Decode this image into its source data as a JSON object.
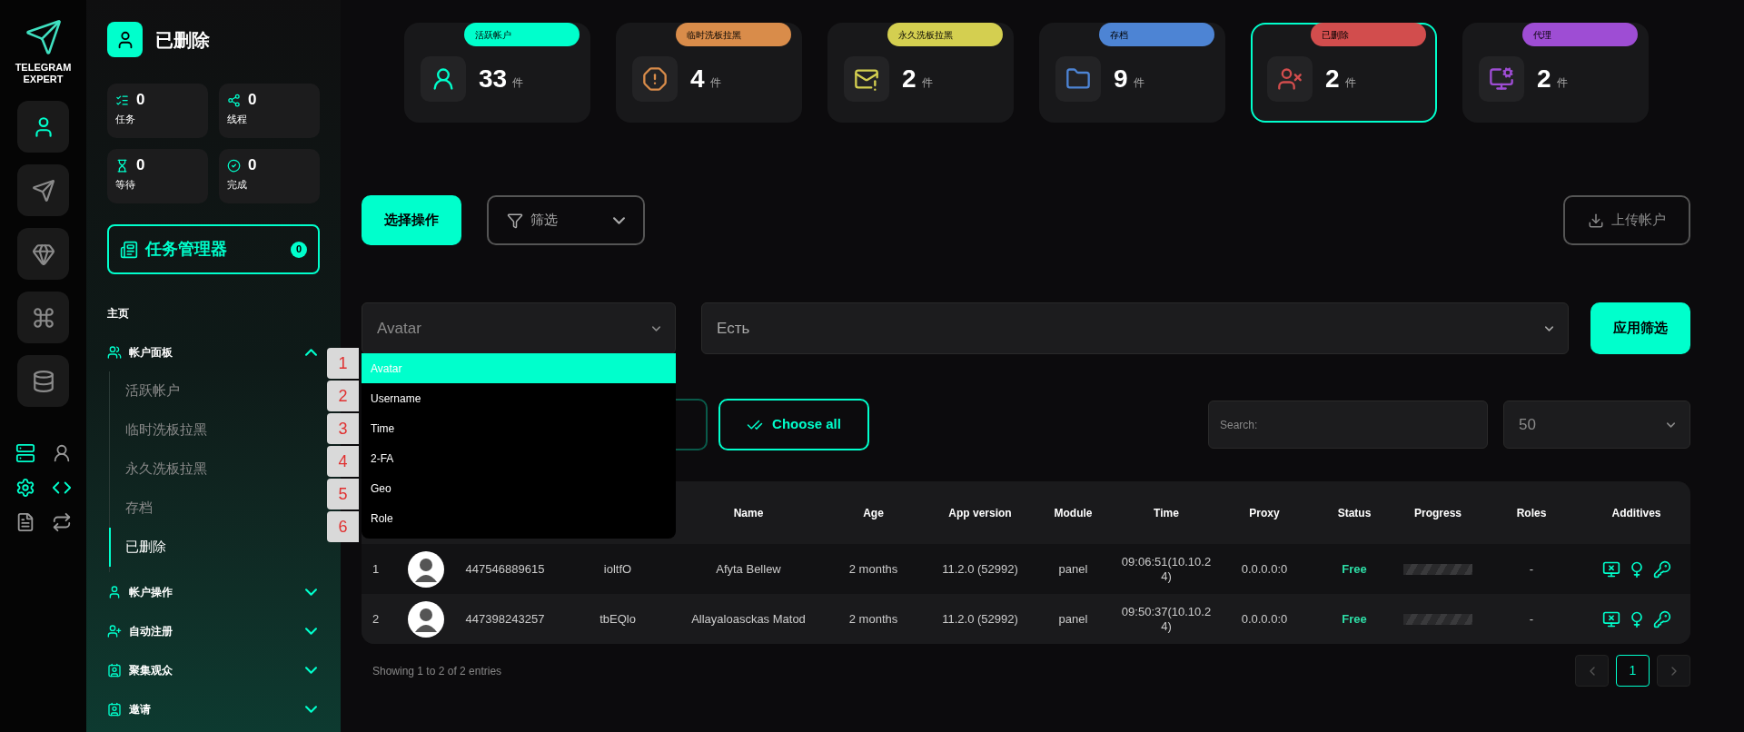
{
  "logo": {
    "line1": "TELEGRAM",
    "line2": "EXPERT"
  },
  "rail": [
    {
      "selected": true
    },
    {
      "selected": false
    },
    {
      "selected": false
    },
    {
      "selected": false
    },
    {
      "selected": false
    }
  ],
  "page_title": "已删除",
  "stats": [
    {
      "value": "0",
      "label": "任务"
    },
    {
      "value": "0",
      "label": "线程"
    },
    {
      "value": "0",
      "label": "等待"
    },
    {
      "value": "0",
      "label": "完成"
    }
  ],
  "task_manager": {
    "label": "任务管理器",
    "count": "0"
  },
  "nav": [
    {
      "kind": "heading",
      "label": "主页"
    },
    {
      "kind": "group",
      "label": "帐户面板",
      "expanded": true,
      "children": [
        {
          "label": "活跃帐户",
          "selected": false
        },
        {
          "label": "临时洗板拉黑",
          "selected": false
        },
        {
          "label": "永久洗板拉黑",
          "selected": false
        },
        {
          "label": "存档",
          "selected": false
        },
        {
          "label": "已删除",
          "selected": true
        }
      ]
    },
    {
      "kind": "group",
      "label": "帐户操作",
      "expanded": false
    },
    {
      "kind": "group",
      "label": "自动注册",
      "expanded": false
    },
    {
      "kind": "group",
      "label": "聚集观众",
      "expanded": false
    },
    {
      "kind": "group",
      "label": "邀请",
      "expanded": false
    }
  ],
  "categories": [
    {
      "label": "活跃帐户",
      "count": "33",
      "unit": "件",
      "color": "#00ffcc",
      "selected": false
    },
    {
      "label": "临时洗板拉黑",
      "count": "4",
      "unit": "件",
      "color": "#d98c4a",
      "selected": false
    },
    {
      "label": "永久洗板拉黑",
      "count": "2",
      "unit": "件",
      "color": "#d4cf50",
      "selected": false
    },
    {
      "label": "存档",
      "count": "9",
      "unit": "件",
      "color": "#4d84d4",
      "selected": false
    },
    {
      "label": "已删除",
      "count": "2",
      "unit": "件",
      "color": "#d24d4d",
      "selected": true
    },
    {
      "label": "代理",
      "count": "2",
      "unit": "件",
      "color": "#9e4dd4",
      "selected": false
    }
  ],
  "toolbar": {
    "action_button": "选择操作",
    "filter_button": "筛选",
    "upload_button": "上传帐户"
  },
  "filter": {
    "field": "Avatar",
    "value": "Есть",
    "apply_button": "应用筛选",
    "options": [
      {
        "label": "Avatar",
        "selected": true
      },
      {
        "label": "Username",
        "selected": false
      },
      {
        "label": "Time",
        "selected": false
      },
      {
        "label": "2-FA",
        "selected": false
      },
      {
        "label": "Geo",
        "selected": false
      },
      {
        "label": "Role",
        "selected": false
      }
    ]
  },
  "markers": [
    "1",
    "2",
    "3",
    "4",
    "5",
    "6"
  ],
  "choose_all_button": "Choose all",
  "search": {
    "placeholder": "Search:"
  },
  "page_size": "50",
  "table": {
    "columns": [
      "Name",
      "Age",
      "App version",
      "Module",
      "Time",
      "Proxy",
      "Status",
      "Progress",
      "Roles",
      "Additives"
    ],
    "rows": [
      {
        "index": "1",
        "phone": "447546889615",
        "username": "ioltfO",
        "name": "Afyta Bellew",
        "age": "2 months",
        "app_version": "11.2.0 (52992)",
        "module": "panel",
        "time": "09:06:51(10.10.24)",
        "proxy": "0.0.0.0:0",
        "status": "Free",
        "level": 0,
        "roles": "-"
      },
      {
        "index": "2",
        "phone": "447398243257",
        "username": "tbEQlo",
        "name": "Allayaloasckas Matod",
        "age": "2 months",
        "app_version": "11.2.0 (52992)",
        "module": "panel",
        "time": "09:50:37(10.10.24)",
        "proxy": "0.0.0.0:0",
        "status": "Free",
        "level": 0,
        "roles": "-"
      }
    ]
  },
  "footer": "Showing 1 to 2 of 2 entries",
  "pagination": [
    {
      "label": "1",
      "selected": true
    }
  ]
}
